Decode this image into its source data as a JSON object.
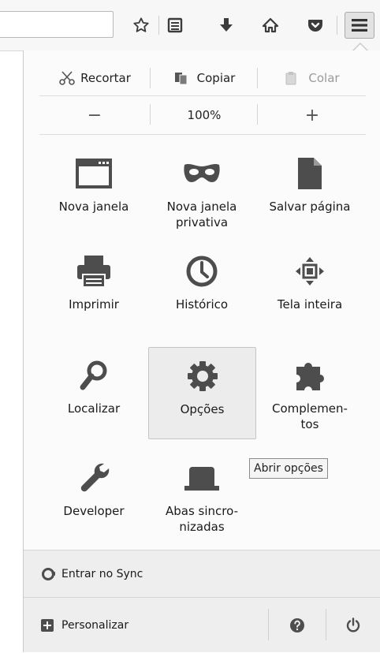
{
  "toolbar": {
    "icons": [
      "bookmark-star-icon",
      "bookmarks-list-icon",
      "downloads-icon",
      "home-icon",
      "pocket-icon",
      "hamburger-menu-icon"
    ]
  },
  "edit": {
    "cut": "Recortar",
    "copy": "Copiar",
    "paste": "Colar"
  },
  "zoom": {
    "minus": "−",
    "level": "100%",
    "plus": "+"
  },
  "grid": [
    {
      "label": "Nova janela",
      "icon": "window-icon"
    },
    {
      "label": "Nova janela\nprivativa",
      "icon": "mask-icon"
    },
    {
      "label": "Salvar página",
      "icon": "page-icon"
    },
    {
      "label": "Imprimir",
      "icon": "printer-icon"
    },
    {
      "label": "Histórico",
      "icon": "clock-icon"
    },
    {
      "label": "Tela inteira",
      "icon": "fullscreen-icon"
    },
    {
      "label": "Localizar",
      "icon": "magnifier-icon"
    },
    {
      "label": "Opções",
      "icon": "gear-icon"
    },
    {
      "label": "Complemen-\ntos",
      "icon": "puzzle-icon"
    },
    {
      "label": "Developer",
      "icon": "wrench-icon"
    },
    {
      "label": "Abas sincro-\nnizadas",
      "icon": "synced-tabs-icon"
    }
  ],
  "tooltip": "Abrir opções",
  "sync": {
    "label": "Entrar no Sync"
  },
  "customize": {
    "label": "Personalizar"
  },
  "colors": {
    "icon": "#4d4d4d",
    "disabled": "#9a9a9a",
    "panel_bg": "#fbfbfb",
    "footer_bg": "#eeeeee"
  }
}
